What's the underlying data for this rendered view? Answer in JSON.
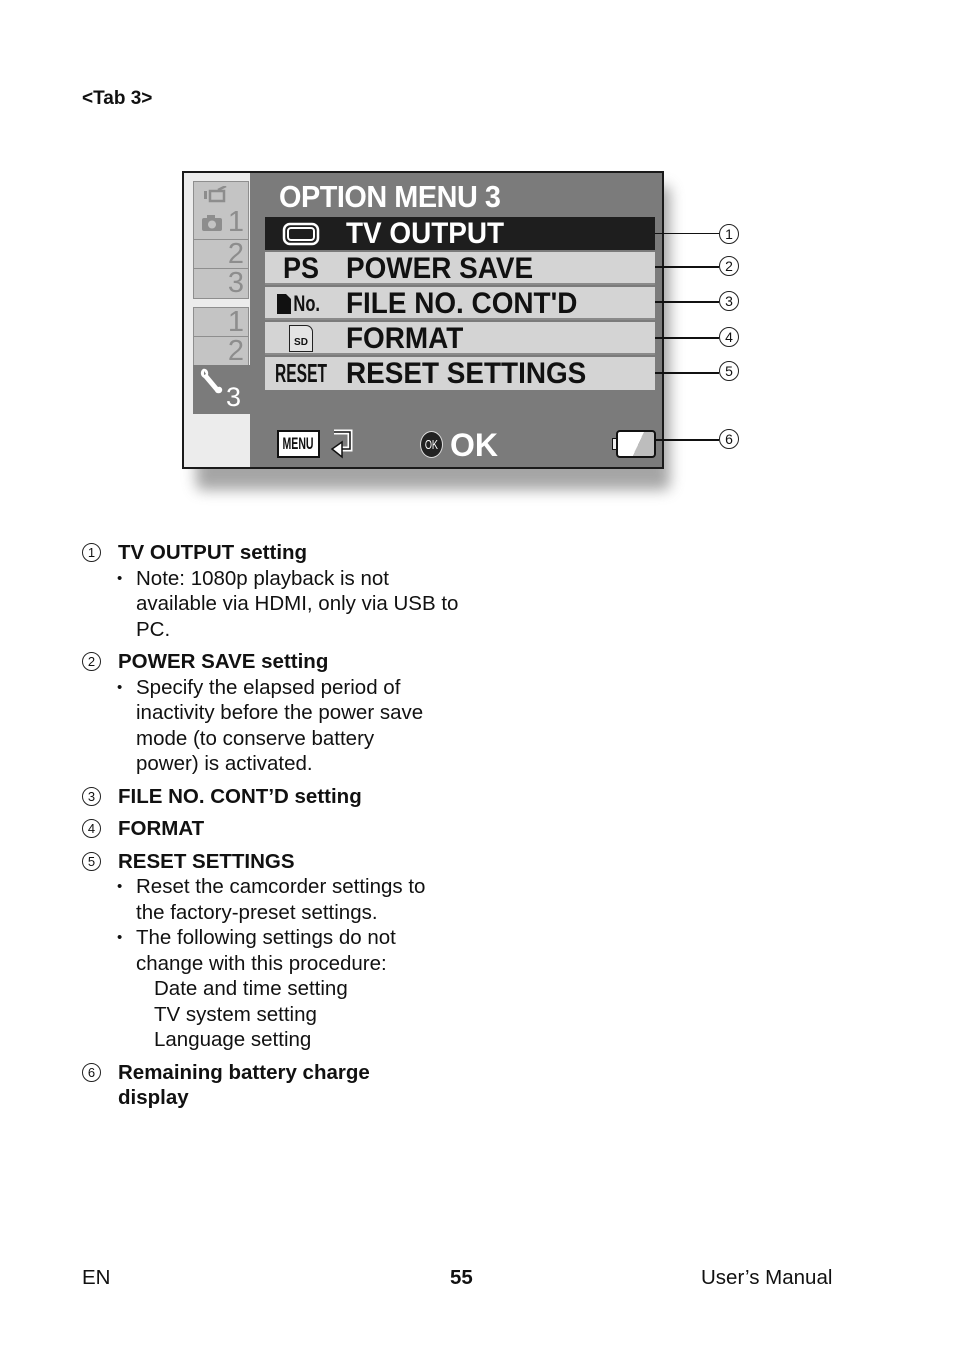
{
  "heading": "<Tab 3>",
  "screen": {
    "title": "OPTION MENU 3",
    "side_tabs": {
      "group1": [
        {
          "icon": "video-camera-icon",
          "label": "1"
        },
        {
          "label": "2"
        },
        {
          "label": "3"
        }
      ],
      "group2": [
        {
          "label": "1"
        },
        {
          "label": "2"
        }
      ],
      "active": {
        "icon": "wrench-icon",
        "label": "3"
      }
    },
    "menu_items": [
      {
        "icon": "tv-icon",
        "icon_text": "",
        "label": "TV OUTPUT",
        "selected": true
      },
      {
        "icon": "ps-icon",
        "icon_text": "PS",
        "label": "POWER SAVE",
        "selected": false
      },
      {
        "icon": "file-no-icon",
        "icon_text": "No.",
        "label": "FILE NO. CONT'D",
        "selected": false
      },
      {
        "icon": "sd-card-icon",
        "icon_text": "SD",
        "label": "FORMAT",
        "selected": false
      },
      {
        "icon": "reset-icon",
        "icon_text": "RESET",
        "label": "RESET SETTINGS",
        "selected": false
      }
    ],
    "bottom": {
      "menu_label": "MENU",
      "ok_badge": "OK",
      "ok_label": "OK"
    },
    "battery_level": "partial",
    "callouts": [
      "1",
      "2",
      "3",
      "4",
      "5",
      "6"
    ]
  },
  "descriptions": [
    {
      "num": "1",
      "title": "TV OUTPUT setting",
      "bullets": [
        "Note: 1080p playback is not available via HDMI, only via USB to PC."
      ],
      "sub": []
    },
    {
      "num": "2",
      "title": "POWER SAVE setting",
      "bullets": [
        "Specify the elapsed period of inactivity before the power save mode (to conserve battery power) is activated."
      ],
      "sub": []
    },
    {
      "num": "3",
      "title": "FILE NO. CONT’D setting",
      "bullets": [],
      "sub": []
    },
    {
      "num": "4",
      "title": "FORMAT",
      "bullets": [],
      "sub": []
    },
    {
      "num": "5",
      "title": "RESET SETTINGS",
      "bullets": [
        "Reset the camcorder settings to the factory-preset settings.",
        "The following settings do not change with this procedure:"
      ],
      "sub": [
        "Date and time setting",
        "TV system setting",
        "Language setting"
      ]
    },
    {
      "num": "6",
      "title": "Remaining battery charge display",
      "bullets": [],
      "sub": []
    }
  ],
  "footer": {
    "left": "EN",
    "page_number": "55",
    "right": "User’s Manual"
  }
}
